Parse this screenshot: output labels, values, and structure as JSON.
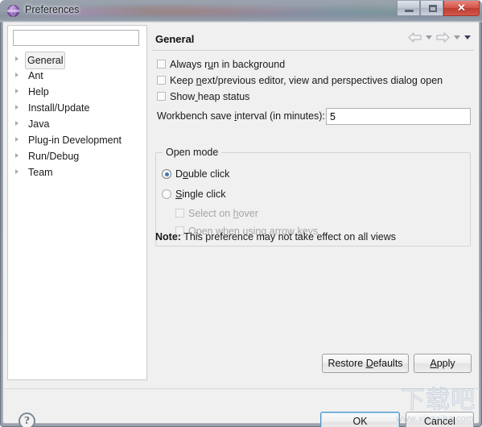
{
  "window": {
    "title": "Preferences",
    "icon": "eclipse-sphere-icon",
    "buttons": {
      "minimize": "minimize-icon",
      "maximize": "maximize-icon",
      "close": "✕"
    }
  },
  "sidebar": {
    "filter": {
      "value": "",
      "placeholder": ""
    },
    "items": [
      {
        "label": "General",
        "selected": true
      },
      {
        "label": "Ant",
        "selected": false
      },
      {
        "label": "Help",
        "selected": false
      },
      {
        "label": "Install/Update",
        "selected": false
      },
      {
        "label": "Java",
        "selected": false
      },
      {
        "label": "Plug-in Development",
        "selected": false
      },
      {
        "label": "Run/Debug",
        "selected": false
      },
      {
        "label": "Team",
        "selected": false
      }
    ]
  },
  "content": {
    "title": "General",
    "nav": {
      "back": "back-arrow-icon",
      "back_menu": "chevron-down-icon",
      "forward": "forward-arrow-icon",
      "forward_menu": "chevron-down-icon",
      "view_menu": "view-menu-icon"
    },
    "checkboxes": [
      {
        "pre": "Always r",
        "mnemonic": "u",
        "post": "n in background",
        "checked": false,
        "enabled": true
      },
      {
        "pre": "Keep ",
        "mnemonic": "n",
        "post": "ext/previous editor, view and perspectives dialog open",
        "checked": false,
        "enabled": true
      },
      {
        "pre": "Show",
        "mnemonic": " ",
        "post": "heap status",
        "checked": false,
        "enabled": true
      }
    ],
    "save_interval": {
      "pre": "Workbench save ",
      "mnemonic": "i",
      "post": "nterval (in minutes):",
      "value": "5"
    },
    "open_mode": {
      "title": "Open mode",
      "radios": [
        {
          "pre": "D",
          "mnemonic": "o",
          "post": "uble click",
          "checked": true
        },
        {
          "pre": "",
          "mnemonic": "S",
          "post": "ingle click",
          "checked": false
        }
      ],
      "sub_checkboxes": [
        {
          "pre": "Select on ",
          "mnemonic": "h",
          "post": "over",
          "checked": false,
          "enabled": false
        },
        {
          "pre": "Open when using arrow ",
          "mnemonic": "k",
          "post": "eys",
          "checked": false,
          "enabled": false
        }
      ],
      "note_label": "Note:",
      "note_text": "This preference may not take effect on all views"
    },
    "restore_defaults": {
      "pre": "Restore ",
      "mnemonic": "D",
      "post": "efaults"
    },
    "apply": {
      "pre": "",
      "mnemonic": "A",
      "post": "pply"
    }
  },
  "footer": {
    "help": "?",
    "ok": "OK",
    "cancel": "Cancel"
  },
  "watermark": {
    "cjk": "下载吧",
    "url": "www.xiazaiba.com"
  },
  "colors": {
    "accent": "#3f76b5",
    "focus_border": "#4a94c9",
    "close_button": "#c4493d",
    "dialog_bg": "#f0f0f0",
    "panel_bg": "#ffffff"
  }
}
